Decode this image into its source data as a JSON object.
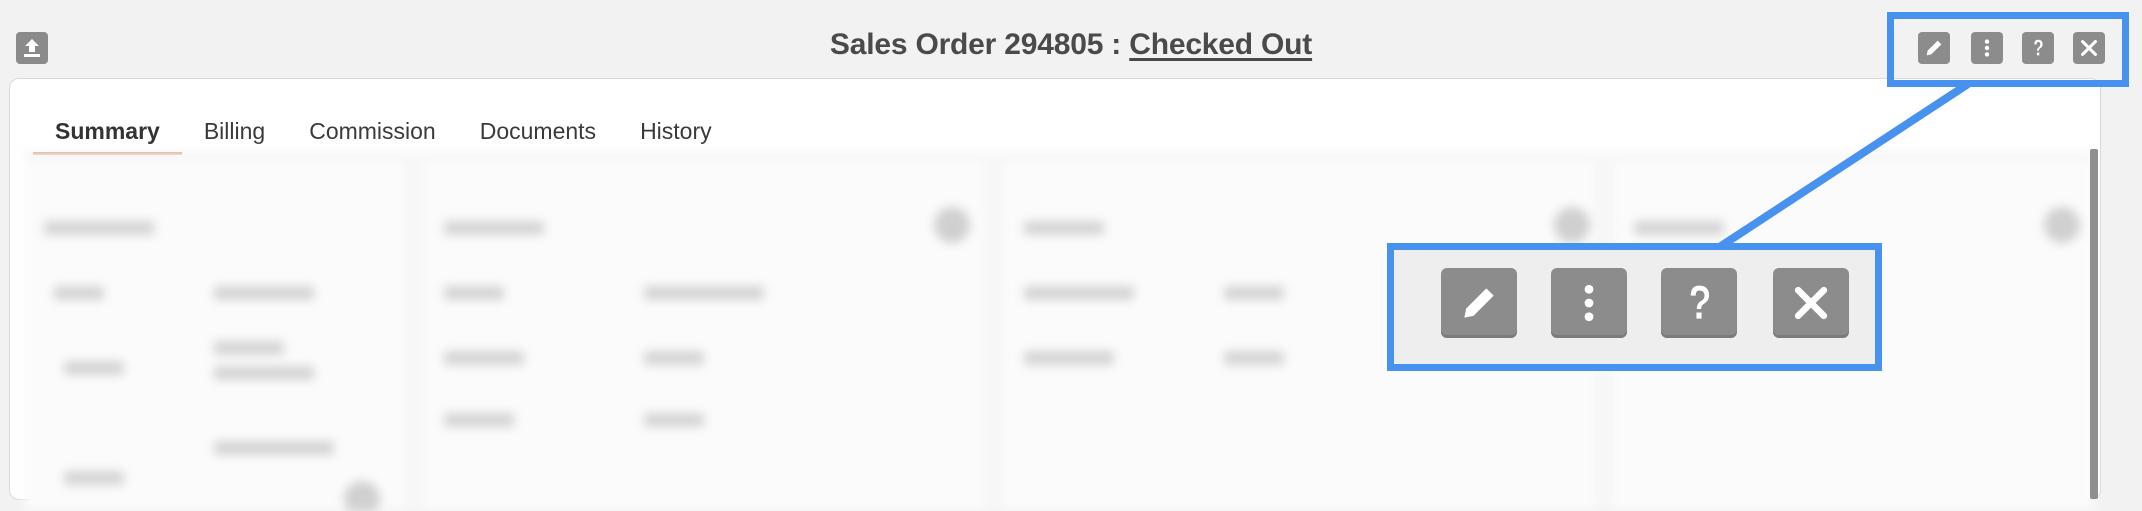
{
  "header": {
    "title_prefix": "Sales Order 294805 : ",
    "status": "Checked Out"
  },
  "toolbar": {
    "icons": [
      "export-icon",
      "pencil-icon",
      "more-vertical-icon",
      "help-icon",
      "close-icon"
    ]
  },
  "tabs": [
    {
      "label": "Summary",
      "active": true
    },
    {
      "label": "Billing",
      "active": false
    },
    {
      "label": "Commission",
      "active": false
    },
    {
      "label": "Documents",
      "active": false
    },
    {
      "label": "History",
      "active": false
    }
  ],
  "colors": {
    "highlight": "#4791ef",
    "active_tab_underline": "#c46a3d",
    "icon_button": "#8c8c8c"
  }
}
